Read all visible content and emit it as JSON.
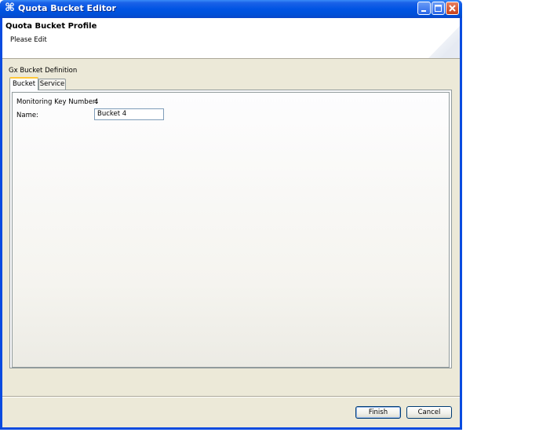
{
  "window": {
    "title": "Quota Bucket Editor",
    "icon": "app-icon"
  },
  "header": {
    "title": "Quota Bucket Profile",
    "subtitle": "Please Edit"
  },
  "group": {
    "label": "Gx Bucket Definition"
  },
  "tabs": [
    {
      "label": "Bucket",
      "active": true
    },
    {
      "label": "Service",
      "active": false
    }
  ],
  "form": {
    "monitoring_key_label": "Monitoring Key Number:",
    "monitoring_key_value": "4",
    "name_label": "Name:",
    "name_value": "Bucket 4"
  },
  "buttons": {
    "finish": "Finish",
    "cancel": "Cancel"
  },
  "colors": {
    "titlebar": "#0054e3",
    "dialog_bg": "#ece9d8",
    "tab_highlight": "#ffc83c"
  }
}
